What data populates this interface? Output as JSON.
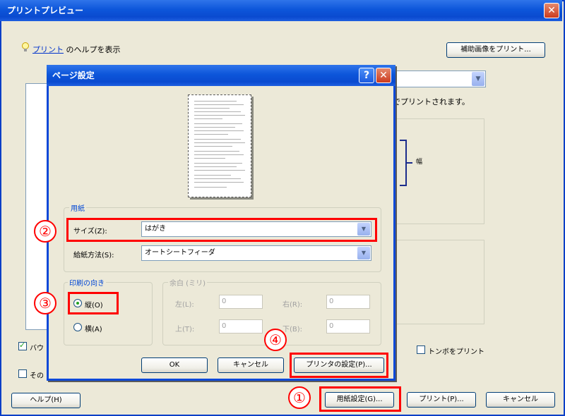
{
  "outer": {
    "title": "プリントプレビュー",
    "help_link": "プリント",
    "help_text": "のヘルプを表示",
    "print_help_button": "補助画像をプリント...",
    "printed_note": "でプリントされます。",
    "side_label": "幅",
    "checkbox_a_label": "バウ",
    "checkbox_b_label": "その",
    "trim_marks_label": "トンボをプリント",
    "help_button": "ヘルプ(H)",
    "paper_setup_button": "用紙設定(G)...",
    "print_button": "プリント(P)...",
    "cancel_button": "キャンセル"
  },
  "dialog": {
    "title": "ページ設定",
    "paper_group": "用紙",
    "size_label": "サイズ(Z):",
    "size_value": "はがき",
    "source_label": "給紙方法(S):",
    "source_value": "オートシートフィーダ",
    "orientation_group": "印刷の向き",
    "portrait_label": "縦(O)",
    "landscape_label": "横(A)",
    "margin_group": "余白 (ミリ)",
    "left_label": "左(L):",
    "right_label": "右(R):",
    "top_label": "上(T):",
    "bottom_label": "下(B):",
    "margin_left": "0",
    "margin_right": "0",
    "margin_top": "0",
    "margin_bottom": "0",
    "ok_button": "OK",
    "cancel_button": "キャンセル",
    "printer_button": "プリンタの設定(P)..."
  },
  "callouts": {
    "one": "①",
    "two": "②",
    "three": "③",
    "four": "④"
  },
  "colors": {
    "highlight": "#ff0000",
    "title_bar": "#0a4ad0",
    "group_label": "#0046d5"
  }
}
